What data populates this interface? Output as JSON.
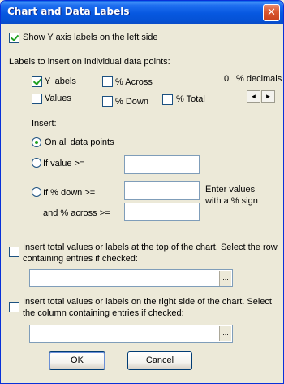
{
  "window": {
    "title": "Chart and Data Labels",
    "close_glyph": "✕"
  },
  "show_y_axis": {
    "label": "Show Y axis labels on the left side",
    "checked": true
  },
  "labels_section": {
    "heading": "Labels to insert on individual data points:",
    "y_labels": {
      "label": "Y labels",
      "checked": true
    },
    "values": {
      "label": "Values",
      "checked": false
    },
    "pct_across": {
      "label": "% Across",
      "checked": false
    },
    "pct_down": {
      "label": "% Down",
      "checked": false
    },
    "pct_total": {
      "label": "% Total",
      "checked": false
    },
    "decimals": {
      "value": "0",
      "label": "% decimals",
      "left_arrow": "◄",
      "right_arrow": "►"
    }
  },
  "insert": {
    "heading": "Insert:",
    "all_points": {
      "label": "On all data points",
      "selected": true
    },
    "if_value": {
      "label": "If value >=",
      "value": ""
    },
    "if_pct_down": {
      "label": "If % down >=",
      "value": ""
    },
    "and_pct_across": {
      "label": "and % across >=",
      "value": ""
    },
    "hint_line1": "Enter values",
    "hint_line2": "with a % sign"
  },
  "top_totals": {
    "line1": "Insert total values or labels at the top of the chart. Select the row",
    "line2": "containing entries if checked:",
    "checked": false,
    "value": "",
    "ref_button": "..."
  },
  "right_totals": {
    "line1": "Insert total values or labels on the right side of the chart. Select",
    "line2": "the column containing entries if checked:",
    "checked": false,
    "value": "",
    "ref_button": "..."
  },
  "buttons": {
    "ok": "OK",
    "cancel": "Cancel"
  }
}
